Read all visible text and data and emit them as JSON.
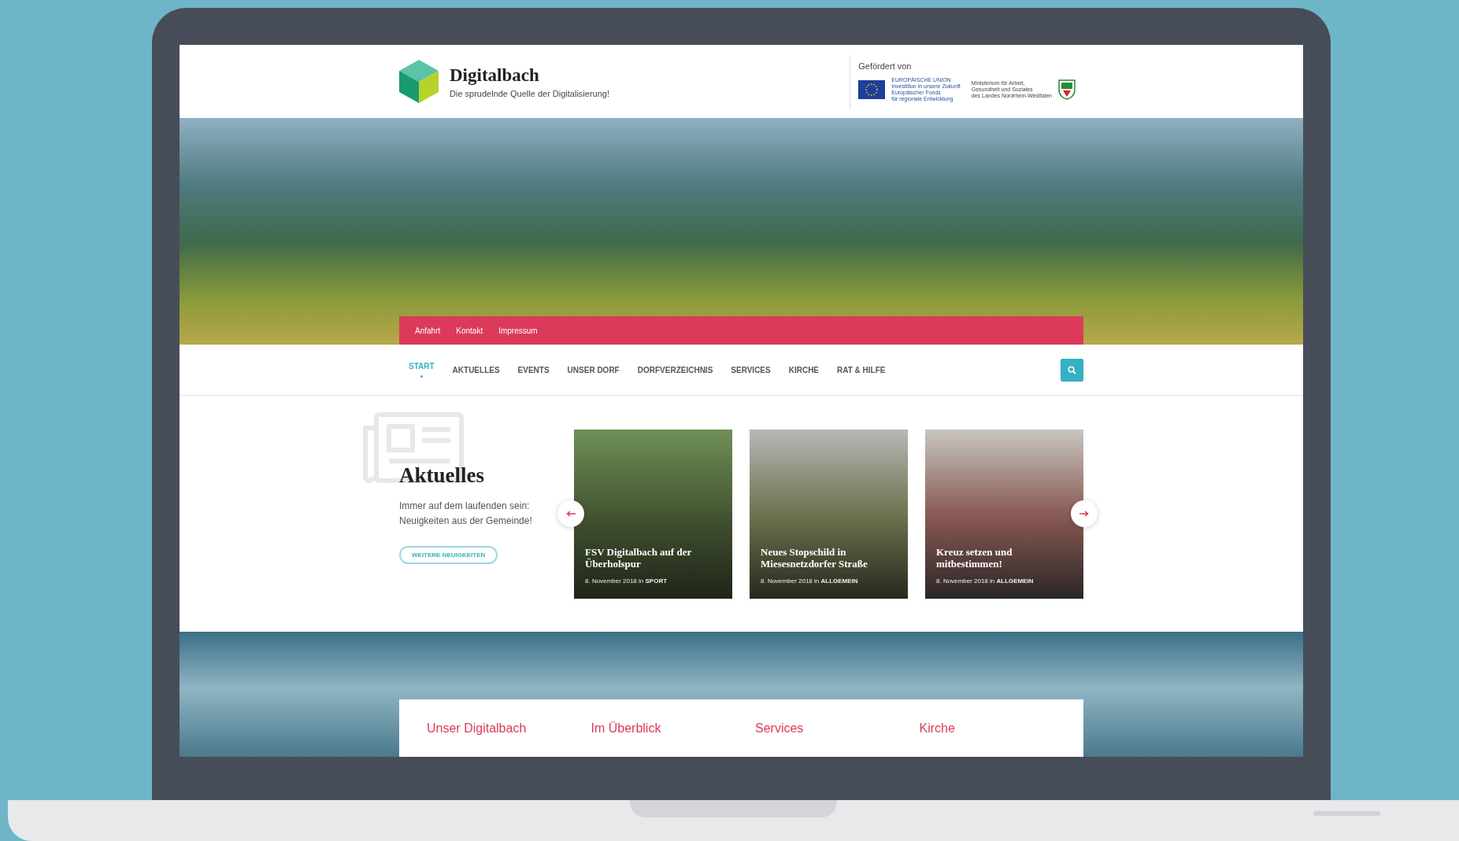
{
  "header": {
    "logo_title": "Digitalbach",
    "tagline": "Die sprudelnde Quelle der Digitalisierung!",
    "funding_label": "Gefördert von",
    "eu_logo_lines": [
      "EUROPÄISCHE UNION",
      "Investition in unsere Zukunft",
      "Europäischer Fonds",
      "für regionale Entwicklung"
    ],
    "ministry_lines": [
      "Ministerium für Arbeit,",
      "Gesundheit und Soziales",
      "des Landes Nordrhein-Westfalen"
    ]
  },
  "top_links": [
    "Anfahrt",
    "Kontakt",
    "Impressum"
  ],
  "nav": [
    {
      "label": "START",
      "selected": true
    },
    {
      "label": "AKTUELLES",
      "selected": false
    },
    {
      "label": "EVENTS",
      "selected": false
    },
    {
      "label": "UNSER DORF",
      "selected": false
    },
    {
      "label": "DORFVERZEICHNIS",
      "selected": false
    },
    {
      "label": "SERVICES",
      "selected": false
    },
    {
      "label": "KIRCHE",
      "selected": false
    },
    {
      "label": "RAT & HILFE",
      "selected": false
    }
  ],
  "news": {
    "title": "Aktuelles",
    "text_lines": [
      "Immer auf dem laufenden sein:",
      "Neuigkeiten aus der Gemeinde!"
    ],
    "button": "WEITERE NEUIGKEITEN",
    "cards": [
      {
        "title": "FSV Digitalbach auf der Überholspur",
        "meta": "8. November 2018 in **SPORT**"
      },
      {
        "title": "Neues Stopschild in Miesesnetzdorfer Straße",
        "meta": "8. November 2018 in **ALLGEMEIN**"
      },
      {
        "title": "Kreuz setzen und mitbestimmen!",
        "meta": "8. November 2018 in **ALLGEMEIN**"
      }
    ]
  },
  "sections": [
    {
      "title": "Unser Digitalbach"
    },
    {
      "title": "Im Überblick"
    },
    {
      "title": "Services"
    },
    {
      "title": "Kirche"
    }
  ]
}
